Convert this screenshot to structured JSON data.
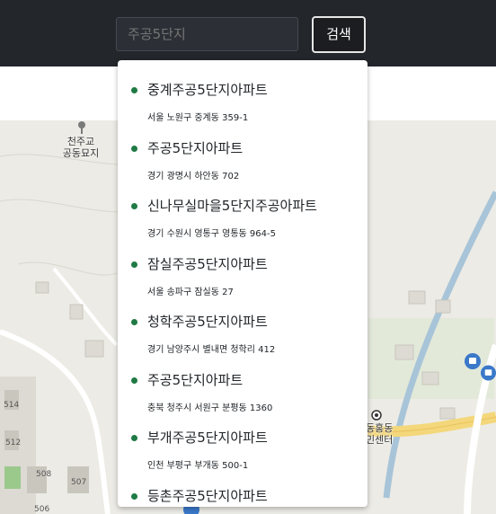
{
  "header": {
    "search": {
      "placeholder": "주공5단지",
      "value": ""
    },
    "search_button_label": "검색"
  },
  "suggestions": [
    {
      "name": "중계주공5단지아파트",
      "address": "서울 노원구 중계동 359-1"
    },
    {
      "name": "주공5단지아파트",
      "address": "경기 광명시 하안동 702"
    },
    {
      "name": "신나무실마을5단지주공아파트",
      "address": "경기 수원시 영통구 영통동 964-5"
    },
    {
      "name": "잠실주공5단지아파트",
      "address": "서울 송파구 잠실동 27"
    },
    {
      "name": "청학주공5단지아파트",
      "address": "경기 남양주시 별내면 청학리 412"
    },
    {
      "name": "주공5단지아파트",
      "address": "충북 청주시 서원구 분평동 1360"
    },
    {
      "name": "부개주공5단지아파트",
      "address": "인천 부평구 부개동 500-1"
    },
    {
      "name": "등촌주공5단지아파트",
      "address": ""
    }
  ],
  "map": {
    "labels": {
      "cemetery": "천주교\n공동묘지",
      "center_line1": "동홍동",
      "center_line2": "민센터"
    },
    "building_numbers": [
      "514",
      "512",
      "508",
      "507",
      "506"
    ],
    "icons": [
      "landmark-pin-icon",
      "bus-stop-icon",
      "bus-stop-icon",
      "bus-stop-icon",
      "poi-dot-icon"
    ]
  },
  "colors": {
    "topbar": "#23262b",
    "accent_dot": "#1f7a44",
    "map_bg": "#ecebe5",
    "river": "#a8c4d8",
    "road_yellow": "#f4d77a",
    "bus_icon": "#3a78c9"
  }
}
